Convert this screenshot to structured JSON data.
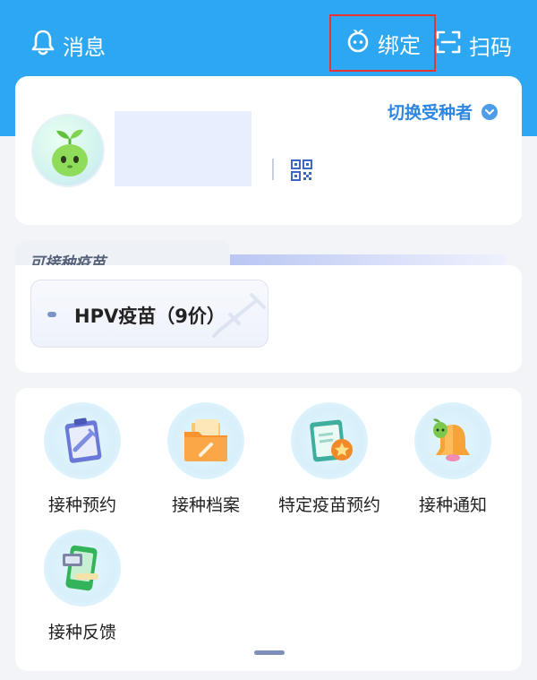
{
  "topbar": {
    "messages_label": "消息",
    "bind_label": "绑定",
    "scan_label": "扫码"
  },
  "profile": {
    "switch_label": "切换受种者"
  },
  "vaccines": {
    "section_title": "可接种疫苗",
    "items": [
      {
        "label": "HPV疫苗（9价）"
      }
    ]
  },
  "services": {
    "items": [
      {
        "label": "接种预约",
        "icon": "clipboard-syringe-icon"
      },
      {
        "label": "接种档案",
        "icon": "folder-syringe-icon"
      },
      {
        "label": "特定疫苗预约",
        "icon": "clipboard-star-icon"
      },
      {
        "label": "接种通知",
        "icon": "bell-sprout-icon"
      },
      {
        "label": "接种反馈",
        "icon": "phone-feedback-icon"
      }
    ]
  },
  "colors": {
    "header_blue": "#2ea7f2",
    "accent_blue": "#2d86e0",
    "highlight_red": "#e8352e"
  }
}
